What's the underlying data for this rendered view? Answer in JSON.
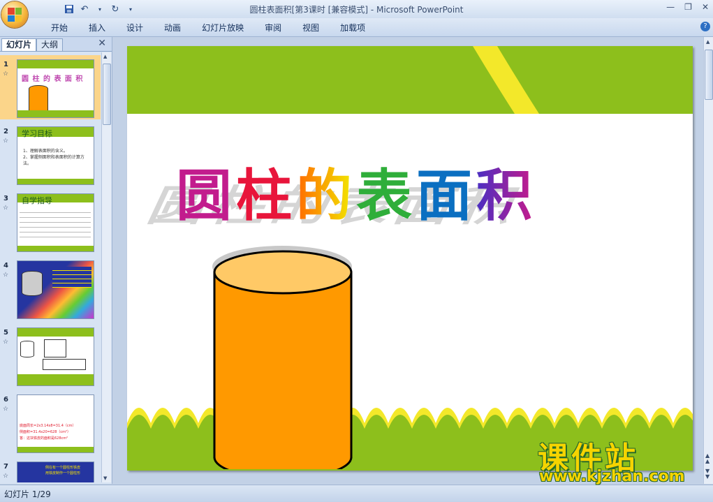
{
  "window": {
    "title": "圆柱表面积[第3课时 [兼容模式] - Microsoft PowerPoint"
  },
  "ribbon": {
    "tabs": [
      "开始",
      "插入",
      "设计",
      "动画",
      "幻灯片放映",
      "审阅",
      "视图",
      "加载项"
    ]
  },
  "panel": {
    "tab_slides": "幻灯片",
    "tab_outline": "大纲",
    "selected_slide": 1,
    "slide_numbers": [
      "1",
      "2",
      "3",
      "4",
      "5",
      "6",
      "7"
    ]
  },
  "thumbs": {
    "s1_title": "圆 柱 的 表 面 积",
    "s2_title": "学习目标",
    "s2_line1": "1、理解表面积的含义。",
    "s2_line2": "2、掌握侧面积和表面积的计算方法。",
    "s3_title": "自学指导",
    "s6_line1": "底面周长=2x3.14x8=31.4（cm）",
    "s6_line2": "侧面积=31.4x20=628（cm²）",
    "s6_line3": "答：这块铁皮的面积是628cm²",
    "s7_line1": "例在有一个圆柱形铁皮",
    "s7_line2": "用铁皮制作一个圆柱形"
  },
  "slide": {
    "title": "圆柱的表面积",
    "title_chars": [
      "圆",
      "柱",
      "的",
      "表",
      "面",
      "积"
    ],
    "colors": {
      "green_band": "#8dbf1c",
      "yellow_stripe": "#f3e82a",
      "cylinder_body": "#ff9900",
      "cylinder_top": "#ffc966"
    }
  },
  "status": {
    "slide_indicator": "幻灯片 1/29"
  },
  "watermark": {
    "line1": "课件站",
    "line2": "www.kjzhan.com"
  }
}
